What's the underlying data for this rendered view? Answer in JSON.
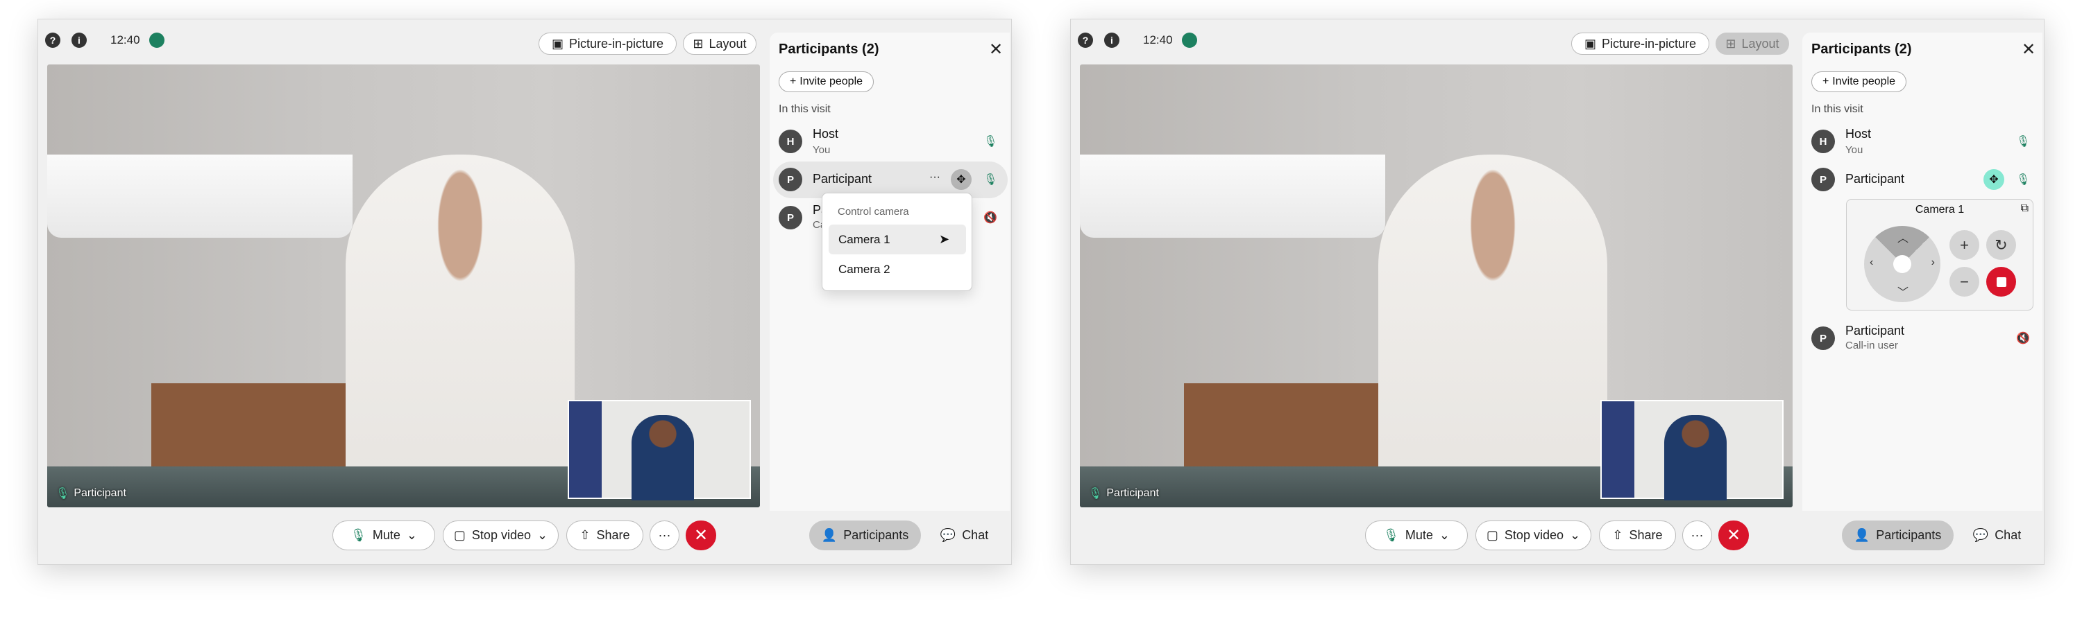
{
  "colors": {
    "accent_green": "#1d8160",
    "danger_red": "#d9152b",
    "camera_active": "#86e8d2"
  },
  "top": {
    "help_icon": "?",
    "info_icon": "i",
    "time": "12:40",
    "pip_label": "Picture-in-picture",
    "layout_label": "Layout"
  },
  "video": {
    "remote_label": "Participant"
  },
  "toolbar": {
    "mute": "Mute",
    "stop_video": "Stop video",
    "share": "Share",
    "more": "···",
    "end": "✕",
    "participants": "Participants",
    "chat": "Chat"
  },
  "panel": {
    "title": "Participants (2)",
    "close": "✕",
    "invite": "Invite people",
    "section": "In this visit",
    "participants": [
      {
        "initial": "H",
        "name": "Host",
        "sub": "You",
        "mic": "on"
      },
      {
        "initial": "P",
        "name": "Participant",
        "sub": "",
        "mic": "on"
      },
      {
        "initial": "P",
        "name": "Participant",
        "sub": "Call-in user",
        "mic": "muted"
      }
    ]
  },
  "left_state": {
    "menu_header": "Control camera",
    "menu_items": [
      "Camera 1",
      "Camera 2"
    ],
    "hovered_item": "Camera 1",
    "layout_enabled": true
  },
  "right_state": {
    "camera_title": "Camera 1",
    "layout_enabled": false
  }
}
